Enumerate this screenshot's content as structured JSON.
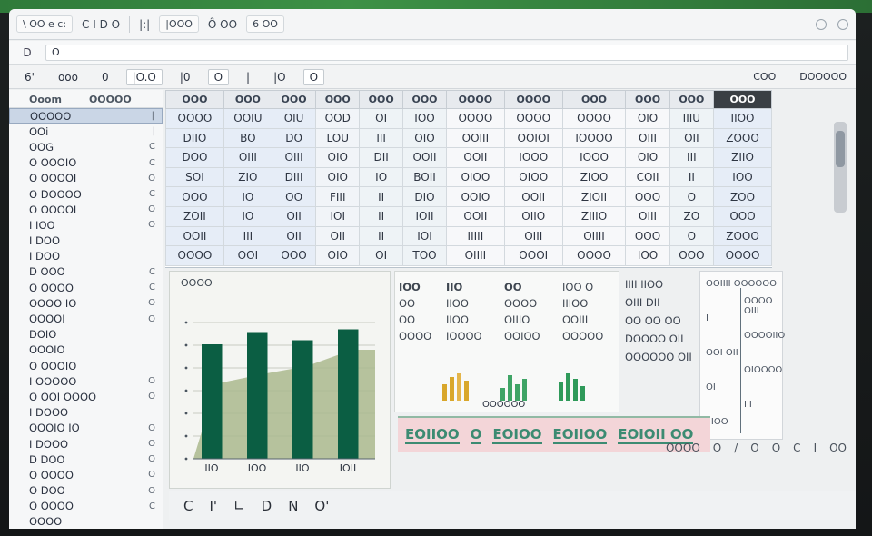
{
  "colors": {
    "accent": "#0b5e43",
    "bar_dark": "#0b5e43",
    "bar_light": "#a9b98c",
    "legend_bg": "#f3d5d8"
  },
  "titlebar": {
    "items": [
      "\\ OO e c:",
      "C I D O",
      "|:|",
      "|OOO",
      "Ȏ OO",
      "6 OO"
    ]
  },
  "formulabar": {
    "cell": "D",
    "value": "O"
  },
  "ribbon": {
    "items": [
      "6'",
      "ooo",
      "0",
      "|O.O",
      "|0",
      "O",
      "|",
      "|O",
      "O"
    ],
    "right": [
      "COO",
      "DOOOOO"
    ]
  },
  "sidebar": {
    "header": [
      "Ooom",
      "OOOOO"
    ],
    "rows": [
      {
        "label": "OOOOO",
        "num": "|"
      },
      {
        "label": "OOi",
        "num": "|"
      },
      {
        "label": "OOG",
        "num": "C"
      },
      {
        "label": "O OOOIO",
        "num": "C"
      },
      {
        "label": "O OOOOI",
        "num": "O"
      },
      {
        "label": "O DOOOO",
        "num": "C"
      },
      {
        "label": "O OOOOI",
        "num": "O"
      },
      {
        "label": "I IOO",
        "num": "O"
      },
      {
        "label": "I DOO",
        "num": "I"
      },
      {
        "label": "I DOO",
        "num": "I"
      },
      {
        "label": "D OOO",
        "num": "C"
      },
      {
        "label": "O OOOO",
        "num": "C"
      },
      {
        "label": "OOOO IO",
        "num": "O"
      },
      {
        "label": "OOOOI",
        "num": "O"
      },
      {
        "label": "DOIO",
        "num": "I"
      },
      {
        "label": "OOOIO",
        "num": "I"
      },
      {
        "label": "O OOOIO",
        "num": "I"
      },
      {
        "label": "I OOOOO",
        "num": "O"
      },
      {
        "label": "O OOI OOOO",
        "num": "O"
      },
      {
        "label": "I DOOO",
        "num": "I"
      },
      {
        "label": "OOOIO IO",
        "num": "O"
      },
      {
        "label": "I DOOO",
        "num": "O"
      },
      {
        "label": "D DOO",
        "num": "O"
      },
      {
        "label": "O OOOO",
        "num": "O"
      },
      {
        "label": "O DOO",
        "num": "O"
      },
      {
        "label": "O OOOO",
        "num": "C"
      },
      {
        "label": "OOOO",
        "num": ""
      }
    ]
  },
  "grid": {
    "headers": [
      "OOO",
      "OOO",
      "OOO",
      "OOO",
      "OOO",
      "OOO",
      "OOOO",
      "OOOO",
      "OOO",
      "OOO",
      "OOO",
      "OOO"
    ],
    "rows": [
      [
        "OOOO",
        "OOIU",
        "OIU",
        "OOD",
        "OI",
        "IOO",
        "OOOO",
        "OOOO",
        "OOOO",
        "OIO",
        "IIIU",
        "IIOO"
      ],
      [
        "DIIO",
        "BO",
        "DO",
        "LOU",
        "III",
        "OIO",
        "OOIII",
        "OOIOI",
        "IOOOO",
        "OIII",
        "OII",
        "ZOOO"
      ],
      [
        "DOO",
        "OIII",
        "OIII",
        "OIO",
        "DII",
        "OOII",
        "OOII",
        "IOOO",
        "IOOO",
        "OIO",
        "III",
        "ZIIO"
      ],
      [
        "SOI",
        "ZIO",
        "DIII",
        "OIO",
        "IO",
        "BOII",
        "OIOO",
        "OIOO",
        "ZIOO",
        "COII",
        "II",
        "IOO"
      ],
      [
        "OOO",
        "IO",
        "OO",
        "FIII",
        "II",
        "DIO",
        "OOIO",
        "OOII",
        "ZIOII",
        "OOO",
        "O",
        "ZOO"
      ],
      [
        "ZOII",
        "IO",
        "OII",
        "IOI",
        "II",
        "IOII",
        "OOII",
        "OIIO",
        "ZIIIO",
        "OIII",
        "ZO",
        "OOO"
      ],
      [
        "OOII",
        "III",
        "OII",
        "OII",
        "II",
        "IOI",
        "IIIII",
        "OIII",
        "OIIII",
        "OOO",
        "O",
        "ZOOO"
      ],
      [
        "OOOO",
        "OOI",
        "OOO",
        "OIO",
        "OI",
        "TOO",
        "OIIII",
        "OOOI",
        "OOOO",
        "IOO",
        "OOO",
        "OOOO"
      ]
    ]
  },
  "chart_data": {
    "type": "bar",
    "title": "OOOO",
    "categories": [
      "IIO",
      "IOO",
      "IIO",
      "IOII"
    ],
    "values": [
      84,
      93,
      87,
      95
    ],
    "area_values": [
      55,
      62,
      68,
      80
    ],
    "ylim": [
      0,
      100
    ],
    "grid": true,
    "legend": "none"
  },
  "stats": {
    "cols": [
      {
        "head": "IOO",
        "items": [
          "OO",
          "OO",
          "OOOO"
        ],
        "cls": "g1"
      },
      {
        "head": "IIO",
        "items": [
          "IIOO",
          "IIOO",
          "IOOOO"
        ],
        "cls": "g2"
      },
      {
        "head": "OO",
        "items": [
          "OOOO",
          "OIIIO",
          "OOIOO"
        ],
        "cls": "g1"
      },
      {
        "head": "IOO O",
        "items": [
          "IIIOO",
          "OOIII",
          "OOOOO"
        ],
        "cls": ""
      }
    ],
    "footer": "OOOOOO"
  },
  "rightstats": [
    "IIII  IIOO",
    "OIII  DII",
    "OO OO  OO",
    "DOOOO  OII",
    "OOOOOO OII"
  ],
  "legend": [
    "EOIIOO",
    "O",
    "EOIOO",
    "EOIIOO",
    "EOIOII OO"
  ],
  "axispane": {
    "labels": [
      "OOIIII OOOOOO",
      "OOOO OIII",
      "I",
      "OOOOIIO",
      "OOI OII",
      "OIOOOO",
      "OI",
      "III",
      "IIIOO"
    ]
  },
  "bottombar": [
    "C",
    "I'",
    "∟",
    "D",
    "N",
    "O'"
  ],
  "status": [
    "OOOO",
    "O",
    "/",
    "O",
    "O",
    "C",
    "I",
    "OO"
  ]
}
